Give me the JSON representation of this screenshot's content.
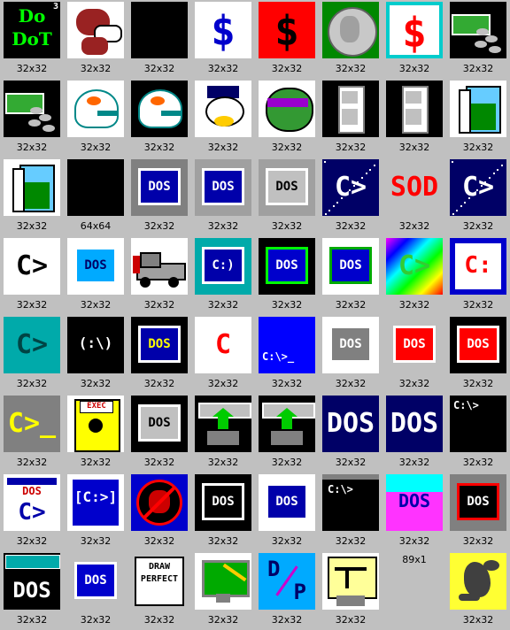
{
  "page": {
    "background": "#c0c0c0"
  },
  "icons": [
    {
      "name": "do-dot-icon",
      "label": "32x32",
      "style": "dodot",
      "text": "Do DoT",
      "badge": "3"
    },
    {
      "name": "dog-icon",
      "label": "32x32",
      "style": "dog"
    },
    {
      "name": "black-icon",
      "label": "32x32",
      "style": "blank",
      "bg": "#000000"
    },
    {
      "name": "dollar-blue-icon",
      "label": "32x32",
      "style": "dollar",
      "bg": "#ffffff",
      "fg": "#0000cc",
      "text": "$"
    },
    {
      "name": "dollar-red-icon",
      "label": "32x32",
      "style": "dollar",
      "bg": "#ff0000",
      "fg": "#000000",
      "text": "$"
    },
    {
      "name": "coin-icon",
      "label": "32x32",
      "style": "coin"
    },
    {
      "name": "dollar-outline-icon",
      "label": "32x32",
      "style": "dollar",
      "bg": "#ffffff",
      "fg": "#ff0000",
      "text": "$",
      "frame": "#00cccc"
    },
    {
      "name": "money-stack-icon",
      "label": "32x32",
      "style": "money"
    },
    {
      "name": "money-stack-2-icon",
      "label": "32x32",
      "style": "money"
    },
    {
      "name": "helmet-outline-icon",
      "label": "32x32",
      "style": "helmet",
      "bg": "#ffffff"
    },
    {
      "name": "helmet-icon",
      "label": "32x32",
      "style": "helmet",
      "bg": "#000000"
    },
    {
      "name": "duck-icon",
      "label": "32x32",
      "style": "duck"
    },
    {
      "name": "turtle-icon",
      "label": "32x32",
      "style": "turtle"
    },
    {
      "name": "door-closed-icon",
      "label": "32x32",
      "style": "door",
      "bg": "#000000"
    },
    {
      "name": "door-closed-2-icon",
      "label": "32x32",
      "style": "door",
      "bg": "#000000"
    },
    {
      "name": "door-open-icon",
      "label": "32x32",
      "style": "dooropen"
    },
    {
      "name": "door-open-2-icon",
      "label": "32x32",
      "style": "dooropen"
    },
    {
      "name": "black-large-icon",
      "label": "64x64",
      "style": "blank",
      "bg": "#000000"
    },
    {
      "name": "dos-monitor-icon",
      "label": "32x32",
      "style": "dosbox",
      "bg": "#808080",
      "inner": "#0000aa",
      "fg": "#ffffff",
      "text": "DOS"
    },
    {
      "name": "dos-monitor-2-icon",
      "label": "32x32",
      "style": "dosbox",
      "bg": "#a0a0a0",
      "inner": "#0000aa",
      "fg": "#ffffff",
      "text": "DOS"
    },
    {
      "name": "dos-gray-icon",
      "label": "32x32",
      "style": "dosbox",
      "bg": "#a0a0a0",
      "inner": "#c0c0c0",
      "fg": "#000000",
      "text": "DOS"
    },
    {
      "name": "prompt-starfield-icon",
      "label": "32x32",
      "style": "prompt",
      "bg": "#000066",
      "fg": "#ffffff",
      "text": "C>"
    },
    {
      "name": "dos-mirrored-icon",
      "label": "32x32",
      "style": "plain",
      "bg": "#c0c0c0",
      "fg": "#ff0000",
      "text": "SOD"
    },
    {
      "name": "prompt-starfield-2-icon",
      "label": "32x32",
      "style": "prompt",
      "bg": "#000066",
      "fg": "#ffffff",
      "text": "C>"
    },
    {
      "name": "prompt-white-icon",
      "label": "32x32",
      "style": "plain",
      "bg": "#ffffff",
      "fg": "#000000",
      "text": "C>"
    },
    {
      "name": "dos-cyan-icon",
      "label": "32x32",
      "style": "dosbox",
      "bg": "#ffffff",
      "inner": "#00aaff",
      "fg": "#000066",
      "text": "DOS"
    },
    {
      "name": "tow-truck-icon",
      "label": "32x32",
      "style": "truck"
    },
    {
      "name": "prompt-window-icon",
      "label": "32x32",
      "style": "dosbox",
      "bg": "#00aaaa",
      "inner": "#0000aa",
      "fg": "#ffffff",
      "text": "C:)"
    },
    {
      "name": "dos-green-frame-icon",
      "label": "32x32",
      "style": "dosbox",
      "bg": "#000000",
      "inner": "#0000cc",
      "fg": "#ffffff",
      "text": "DOS",
      "frame": "#00ff00"
    },
    {
      "name": "dos-green-frame-2-icon",
      "label": "32x32",
      "style": "dosbox",
      "bg": "#ffffff",
      "inner": "#0000cc",
      "fg": "#ffffff",
      "text": "DOS",
      "frame": "#00aa00"
    },
    {
      "name": "prompt-rainbow-icon",
      "label": "32x32",
      "style": "rainbow",
      "text": "C>"
    },
    {
      "name": "prompt-red-colon-icon",
      "label": "32x32",
      "style": "plain",
      "bg": "#0000cc",
      "fg": "#ff0000",
      "text": "C:",
      "inner": "#ffffff"
    },
    {
      "name": "prompt-teal-icon",
      "label": "32x32",
      "style": "plain",
      "bg": "#00aaaa",
      "fg": "#004444",
      "text": "C>"
    },
    {
      "name": "prompt-backslash-icon",
      "label": "32x32",
      "style": "plain",
      "bg": "#000000",
      "fg": "#ffffff",
      "text": "(:\\)"
    },
    {
      "name": "dos-yellow-text-icon",
      "label": "32x32",
      "style": "dosbox",
      "bg": "#000000",
      "inner": "#0000aa",
      "fg": "#ffff00",
      "text": "DOS"
    },
    {
      "name": "red-c-icon",
      "label": "32x32",
      "style": "plain",
      "bg": "#ffffff",
      "fg": "#ff0000",
      "text": "C"
    },
    {
      "name": "prompt-blue-icon",
      "label": "32x32",
      "style": "corner",
      "bg": "#0000ff",
      "fg": "#ffffff",
      "text": "C:\\>_"
    },
    {
      "name": "dos-raised-gray-icon",
      "label": "32x32",
      "style": "dosbox",
      "bg": "#ffffff",
      "inner": "#808080",
      "fg": "#ffffff",
      "text": "DOS"
    },
    {
      "name": "dos-red-icon",
      "label": "32x32",
      "style": "dosbox",
      "bg": "#c0c0c0",
      "inner": "#ff0000",
      "fg": "#ffffff",
      "text": "DOS"
    },
    {
      "name": "dos-red-black-icon",
      "label": "32x32",
      "style": "dosbox",
      "bg": "#000000",
      "inner": "#ff0000",
      "fg": "#ffffff",
      "text": "DOS"
    },
    {
      "name": "prompt-yellow-icon",
      "label": "32x32",
      "style": "plain",
      "bg": "#808080",
      "fg": "#ffff00",
      "text": "C>_"
    },
    {
      "name": "exec-disk-icon",
      "label": "32x32",
      "style": "exec",
      "text": "EXEC"
    },
    {
      "name": "dos-pencil-icon",
      "label": "32x32",
      "style": "dosbox",
      "bg": "#000000",
      "inner": "#c0c0c0",
      "fg": "#000000",
      "text": "DOS"
    },
    {
      "name": "drive-arrow-icon",
      "label": "32x32",
      "style": "drive"
    },
    {
      "name": "drive-arrow-2-icon",
      "label": "32x32",
      "style": "drive"
    },
    {
      "name": "dos-navy-icon",
      "label": "32x32",
      "style": "plain",
      "bg": "#000066",
      "fg": "#ffffff",
      "text": "DOS"
    },
    {
      "name": "dos-navy-2-icon",
      "label": "32x32",
      "style": "plain",
      "bg": "#000066",
      "fg": "#ffffff",
      "text": "DOS"
    },
    {
      "name": "terminal-black-icon",
      "label": "32x32",
      "style": "corner",
      "bg": "#000000",
      "fg": "#ffffff",
      "text": "C:\\>"
    },
    {
      "name": "dos-prompt-window-icon",
      "label": "32x32",
      "style": "doswin",
      "text": "DOS",
      "text2": "C>"
    },
    {
      "name": "prompt-bracket-icon",
      "label": "32x32",
      "style": "plain",
      "bg": "#ffffff",
      "fg": "#ffffff",
      "text": "[C:>]",
      "inner": "#0000cc"
    },
    {
      "name": "no-apple-icon",
      "label": "32x32",
      "style": "noapple"
    },
    {
      "name": "dos-bold-white-icon",
      "label": "32x32",
      "style": "dosbox",
      "bg": "#000000",
      "inner": "#000000",
      "fg": "#ffffff",
      "text": "DOS",
      "frame": "#ffffff"
    },
    {
      "name": "dos-blue-frame-icon",
      "label": "32x32",
      "style": "dosbox",
      "bg": "#ffffff",
      "inner": "#0000aa",
      "fg": "#ffffff",
      "text": "DOS"
    },
    {
      "name": "terminal-window-icon",
      "label": "32x32",
      "style": "termwin",
      "text": "C:\\>"
    },
    {
      "name": "dos-magenta-icon",
      "label": "32x32",
      "style": "magenta",
      "text": "DOS"
    },
    {
      "name": "dos-screen-icon",
      "label": "32x32",
      "style": "dosbox",
      "bg": "#808080",
      "inner": "#000000",
      "fg": "#ffffff",
      "text": "DOS",
      "frame": "#ff0000"
    },
    {
      "name": "dos-big-icon",
      "label": "32x32",
      "style": "dosbig",
      "text": "DOS"
    },
    {
      "name": "dos-blue-button-icon",
      "label": "32x32",
      "style": "dosbox",
      "bg": "#c0c0c0",
      "inner": "#0000cc",
      "fg": "#ffffff",
      "text": "DOS"
    },
    {
      "name": "draw-perfect-icon",
      "label": "32x32",
      "style": "drawperfect",
      "text": "DRAW",
      "text2": "PERFECT"
    },
    {
      "name": "paint-monitor-icon",
      "label": "32x32",
      "style": "paint"
    },
    {
      "name": "dp-icon",
      "label": "32x32",
      "style": "dp",
      "text": "D",
      "text2": "P"
    },
    {
      "name": "drafting-icon",
      "label": "32x32",
      "style": "drafting"
    },
    {
      "name": "empty-icon",
      "label": "89x1",
      "style": "empty"
    },
    {
      "name": "dragon-icon",
      "label": "32x32",
      "style": "dragon"
    }
  ]
}
